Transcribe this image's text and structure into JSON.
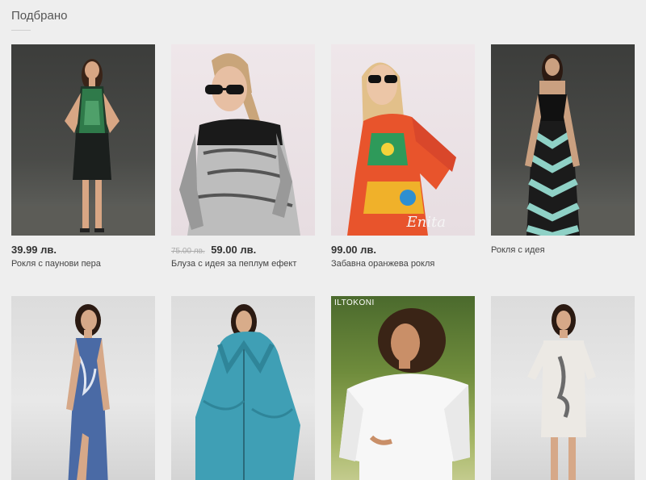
{
  "section": {
    "title": "Подбрано"
  },
  "products": [
    {
      "price": "39.99 лв.",
      "old_price": "",
      "name": "Рокля с паунови пера",
      "badge": "",
      "signature": ""
    },
    {
      "price": "59.00 лв.",
      "old_price": "75.00 лв.",
      "name": "Блуза с идея за пеплум ефект",
      "badge": "",
      "signature": ""
    },
    {
      "price": "99.00 лв.",
      "old_price": "",
      "name": "Забавна оранжева рокля",
      "badge": "",
      "signature": "Enita"
    },
    {
      "price": "",
      "old_price": "",
      "name": "Рокля с идея",
      "badge": "",
      "signature": ""
    },
    {
      "price": "",
      "old_price": "",
      "name": "",
      "badge": "",
      "signature": ""
    },
    {
      "price": "",
      "old_price": "",
      "name": "",
      "badge": "",
      "signature": ""
    },
    {
      "price": "",
      "old_price": "",
      "name": "",
      "badge": "ILTOKONI",
      "signature": ""
    },
    {
      "price": "",
      "old_price": "",
      "name": "",
      "badge": "",
      "signature": ""
    }
  ],
  "colors": {
    "background": "#eeeeee",
    "text": "#333333",
    "old_price": "#aaaaaa"
  }
}
